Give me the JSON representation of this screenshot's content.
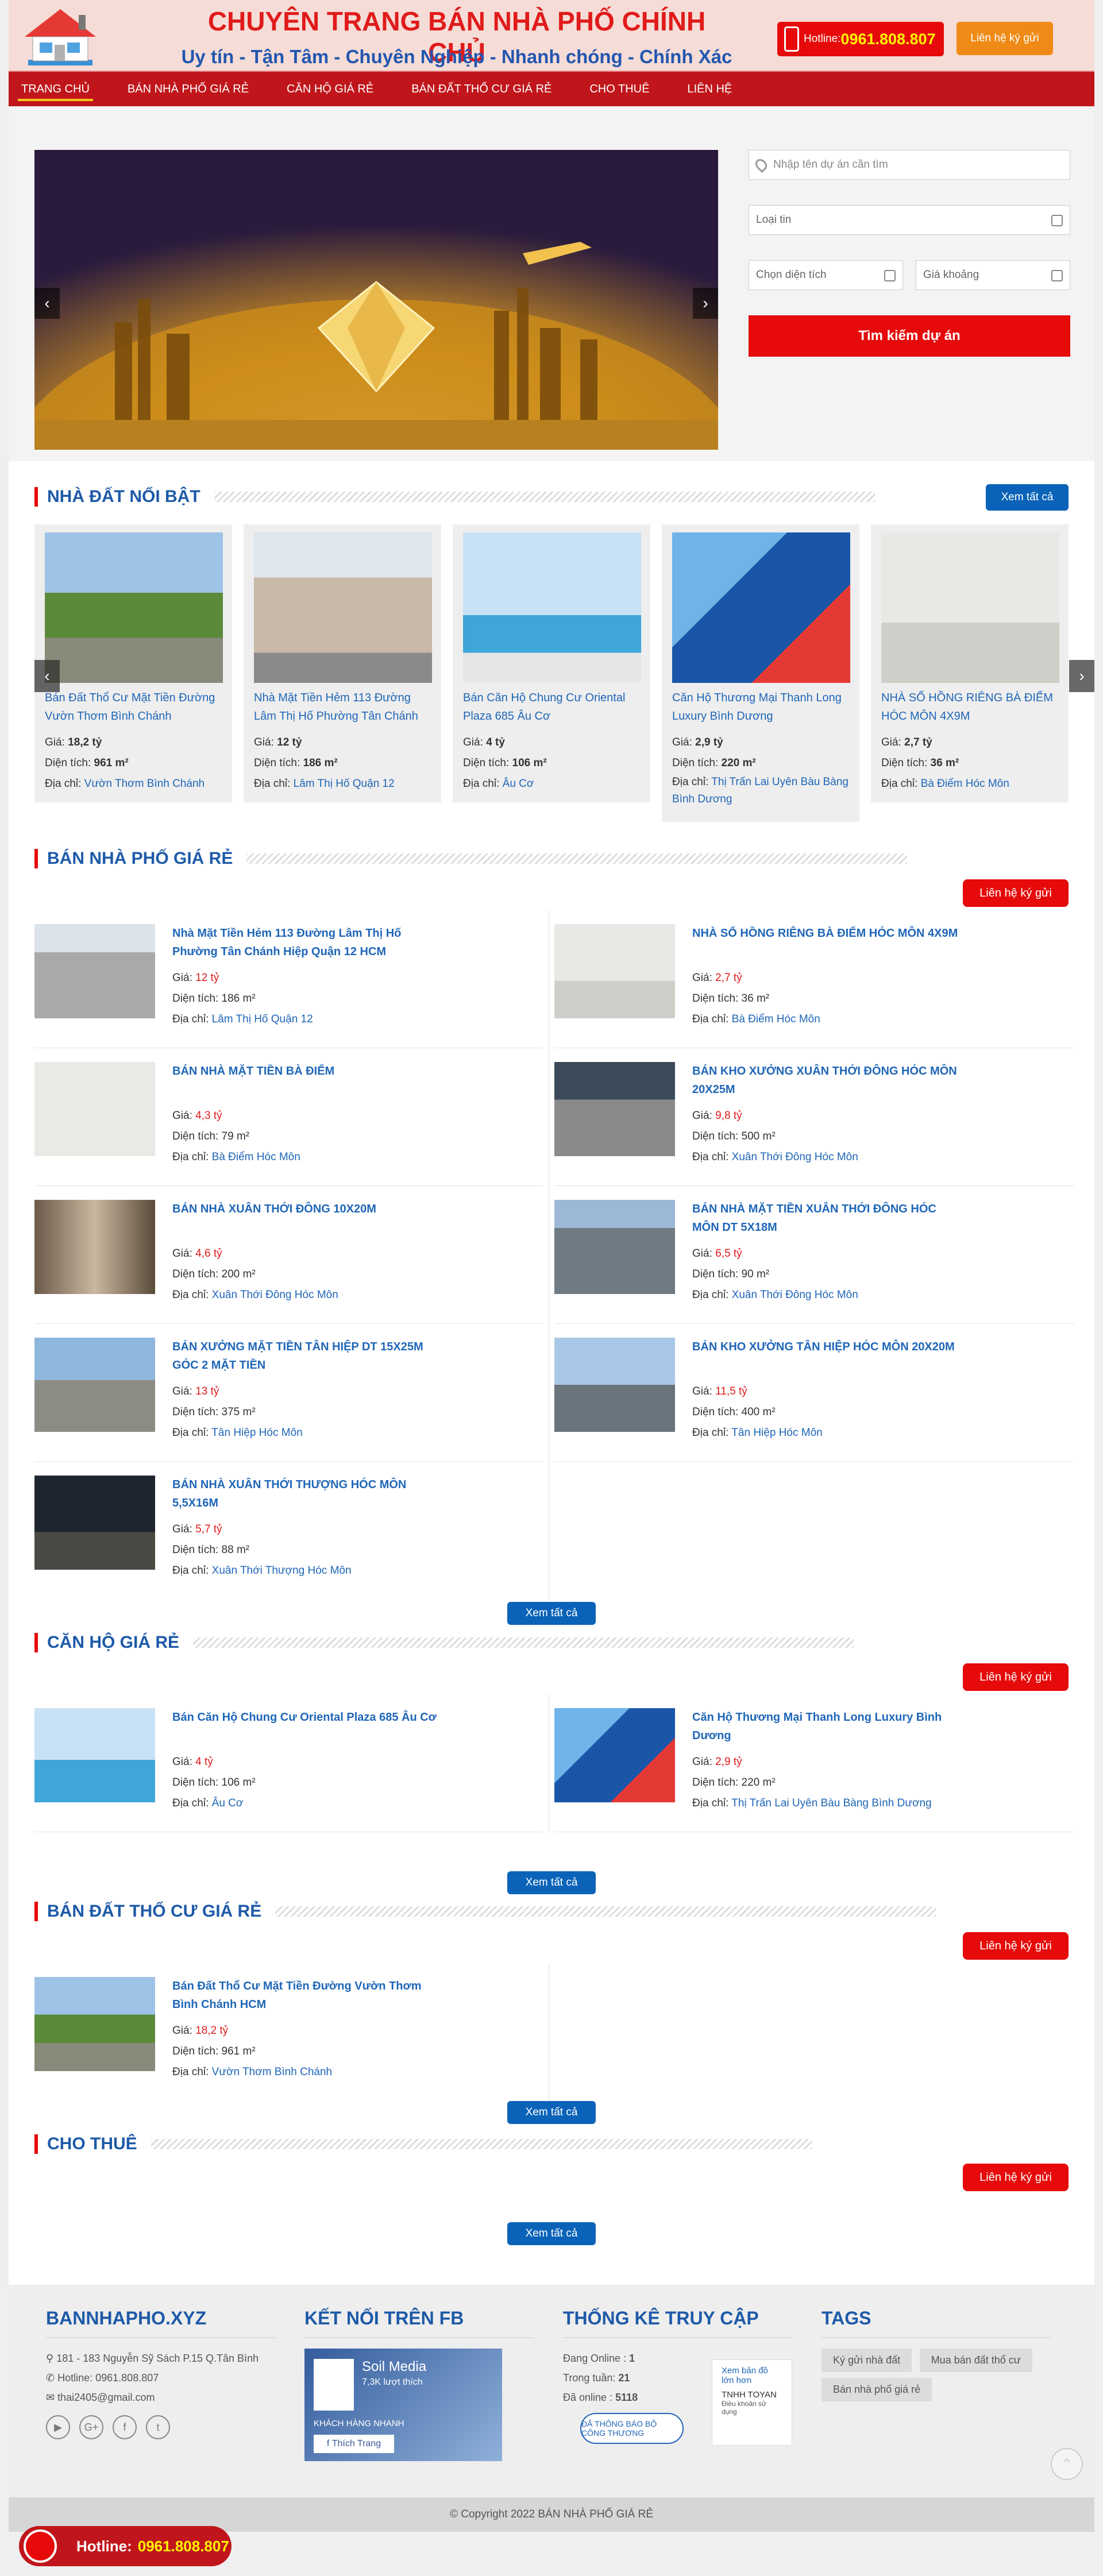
{
  "header": {
    "slogan": "CHUYÊN TRANG BÁN NHÀ PHỐ CHÍNH CHỦ",
    "subtitle": "Uy tín - Tận Tâm - Chuyên Nghiệp - Nhanh chóng - Chính Xác",
    "hotline_label": "Hotline:",
    "hotline_number": "0961.808.807",
    "consign_label": "Liên hệ ký gửi"
  },
  "nav": {
    "items": [
      "TRANG CHỦ",
      "BÁN NHÀ PHỐ GIÁ RẺ",
      "CĂN HỘ GIÁ RẺ",
      "BÁN ĐẤT THỔ CƯ GIÁ RẺ",
      "CHO THUÊ",
      "LIÊN HỆ"
    ]
  },
  "search": {
    "keyword_placeholder": "Nhập tên dự án cần tìm",
    "type_label": "Loại tin",
    "area_label": "Chọn diện tích",
    "price_label": "Giá khoảng",
    "submit_label": "Tìm kiếm dự án"
  },
  "labels": {
    "price": "Giá:",
    "area": "Diện tích:",
    "address": "Địa chỉ:"
  },
  "featured": {
    "title": "NHÀ ĐẤT NỔI BẬT",
    "view_all": "Xem tất cả",
    "items": [
      {
        "title": "Bán Đất Thổ Cư Mặt Tiền Đường Vườn Thơm Bình Chánh",
        "price": "18,2 tỷ",
        "area": "961 m²",
        "address": "Vườn Thơm Bình Chánh"
      },
      {
        "title": "Nhà Mặt Tiền Hẻm 113 Đường Lâm Thị Hố Phường Tân Chánh",
        "price": "12 tỷ",
        "area": "186 m²",
        "address": "Lâm Thị Hố Quận 12"
      },
      {
        "title": "Bán Căn Hộ Chung Cư Oriental Plaza 685 Âu Cơ",
        "price": "4 tỷ",
        "area": "106 m²",
        "address": "Âu Cơ"
      },
      {
        "title": "Căn Hộ Thương Mại Thanh Long Luxury Bình Dương",
        "price": "2,9 tỷ",
        "area": "220 m²",
        "address": "Thị Trấn Lai Uyên Bàu Bàng Bình Dương"
      },
      {
        "title": "NHÀ SỔ HỒNG RIÊNG BÀ ĐIỂM HÓC MÔN 4X9M",
        "price": "2,7 tỷ",
        "area": "36 m²",
        "address": "Bà Điểm Hóc Môn"
      }
    ]
  },
  "nha_pho": {
    "title": "BÁN NHÀ PHỐ GIÁ RẺ",
    "contact": "Liên hệ ký gửi",
    "view_all": "Xem tất cả",
    "items": [
      {
        "title": "Nhà Mặt Tiền Hẻm 113 Đường Lâm Thị Hố Phường Tân Chánh Hiệp Quận 12 HCM",
        "price": "12 tỷ",
        "area": "186 m²",
        "address": "Lâm Thị Hố Quận 12"
      },
      {
        "title": "NHÀ SỔ HỒNG RIÊNG BÀ ĐIỂM HÓC MÔN 4X9M",
        "price": "2,7 tỷ",
        "area": "36 m²",
        "address": "Bà Điểm Hóc Môn"
      },
      {
        "title": "BÁN NHÀ MẶT TIỀN BÀ ĐIỂM",
        "price": "4,3 tỷ",
        "area": "79 m²",
        "address": "Bà Điểm Hóc Môn"
      },
      {
        "title": "BÁN KHO XƯỞNG XUÂN THỚI ĐÔNG HÓC MÔN 20X25M",
        "price": "9,8 tỷ",
        "area": "500 m²",
        "address": "Xuân Thới Đông Hóc Môn"
      },
      {
        "title": "BÁN NHÀ XUÂN THỚI ĐÔNG 10X20M",
        "price": "4,6 tỷ",
        "area": "200 m²",
        "address": "Xuân Thới Đông Hóc Môn"
      },
      {
        "title": "BÁN NHÀ MẶT TIỀN XUÂN THỚI ĐÔNG HÓC MÔN DT 5X18M",
        "price": "6,5 tỷ",
        "area": "90 m²",
        "address": "Xuân Thới Đông Hóc Môn"
      },
      {
        "title": "BÁN XƯỞNG MẶT TIỀN TÂN HIỆP DT 15X25M GÓC 2 MẶT TIỀN",
        "price": "13 tỷ",
        "area": "375 m²",
        "address": "Tân Hiệp Hóc Môn"
      },
      {
        "title": "BÁN KHO XƯỞNG TÂN HIỆP HÓC MÔN 20X20M",
        "price": "11,5 tỷ",
        "area": "400 m²",
        "address": "Tân Hiệp Hóc Môn"
      },
      {
        "title": "BÁN NHÀ XUÂN THỚI THƯỢNG HÓC MÔN 5,5X16M",
        "price": "5,7 tỷ",
        "area": "88 m²",
        "address": "Xuân Thới Thượng Hóc Môn"
      }
    ]
  },
  "can_ho": {
    "title": "CĂN HỘ GIÁ RẺ",
    "contact": "Liên hệ ký gửi",
    "view_all": "Xem tất cả",
    "items": [
      {
        "title": "Bán Căn Hộ Chung Cư Oriental Plaza 685 Âu Cơ",
        "price": "4 tỷ",
        "area": "106 m²",
        "address": "Âu Cơ"
      },
      {
        "title": "Căn Hộ Thương Mại Thanh Long Luxury Bình Dương",
        "price": "2,9 tỷ",
        "area": "220 m²",
        "address": "Thị Trấn Lai Uyên Bàu Bàng Bình Dương"
      }
    ]
  },
  "dat_tho_cu": {
    "title": "BÁN ĐẤT THỔ CƯ GIÁ RẺ",
    "contact": "Liên hệ ký gửi",
    "view_all": "Xem tất cả",
    "items": [
      {
        "title": "Bán Đất Thổ Cư Mặt Tiền Đường Vườn Thơm Bình Chánh HCM",
        "price": "18,2 tỷ",
        "area": "961 m²",
        "address": "Vườn Thơm Bình Chánh"
      }
    ]
  },
  "cho_thue": {
    "title": "CHO THUÊ",
    "contact": "Liên hệ ký gửi",
    "view_all": "Xem tất cả"
  },
  "footer": {
    "brand": "BANNHAPHO.XYZ",
    "address": "181 - 183 Nguyễn Sỹ Sách P.15 Q.Tân Bình",
    "hotline": "Hotline: 0961.808.807",
    "email": "thai2405@gmail.com",
    "fb_title": "KẾT NỐI TRÊN FB",
    "fb_page": "Soil Media",
    "fb_likes": "7,3K lượt thích",
    "fb_shop": "KHÁCH HÀNG NHANH",
    "fb_like_btn": "Thích Trang",
    "stats_title": "THỐNG KÊ TRUY CẬP",
    "online_label": "Đang Online :",
    "online": "1",
    "week_label": "Trong tuần:",
    "week": "21",
    "total_label": "Đã online :",
    "total": "5118",
    "bct": "ĐÃ THÔNG BÁO BỘ CÔNG THƯƠNG",
    "map_link": "Xem bản đồ lớn hơn",
    "map_company": "TNHH TOYAN",
    "map_terms": "Điều khoản sử dụng",
    "tags_title": "TAGS",
    "tags": [
      "Ký gửi nhà đất",
      "Mua bán đất thổ cư",
      "Bán nhà phố giá rẻ"
    ],
    "copyright": "© Copyright 2022 BÁN NHÀ PHỐ GIÁ RẺ"
  },
  "float_hotline": {
    "label": "Hotline:",
    "number": "0961.808.807"
  }
}
